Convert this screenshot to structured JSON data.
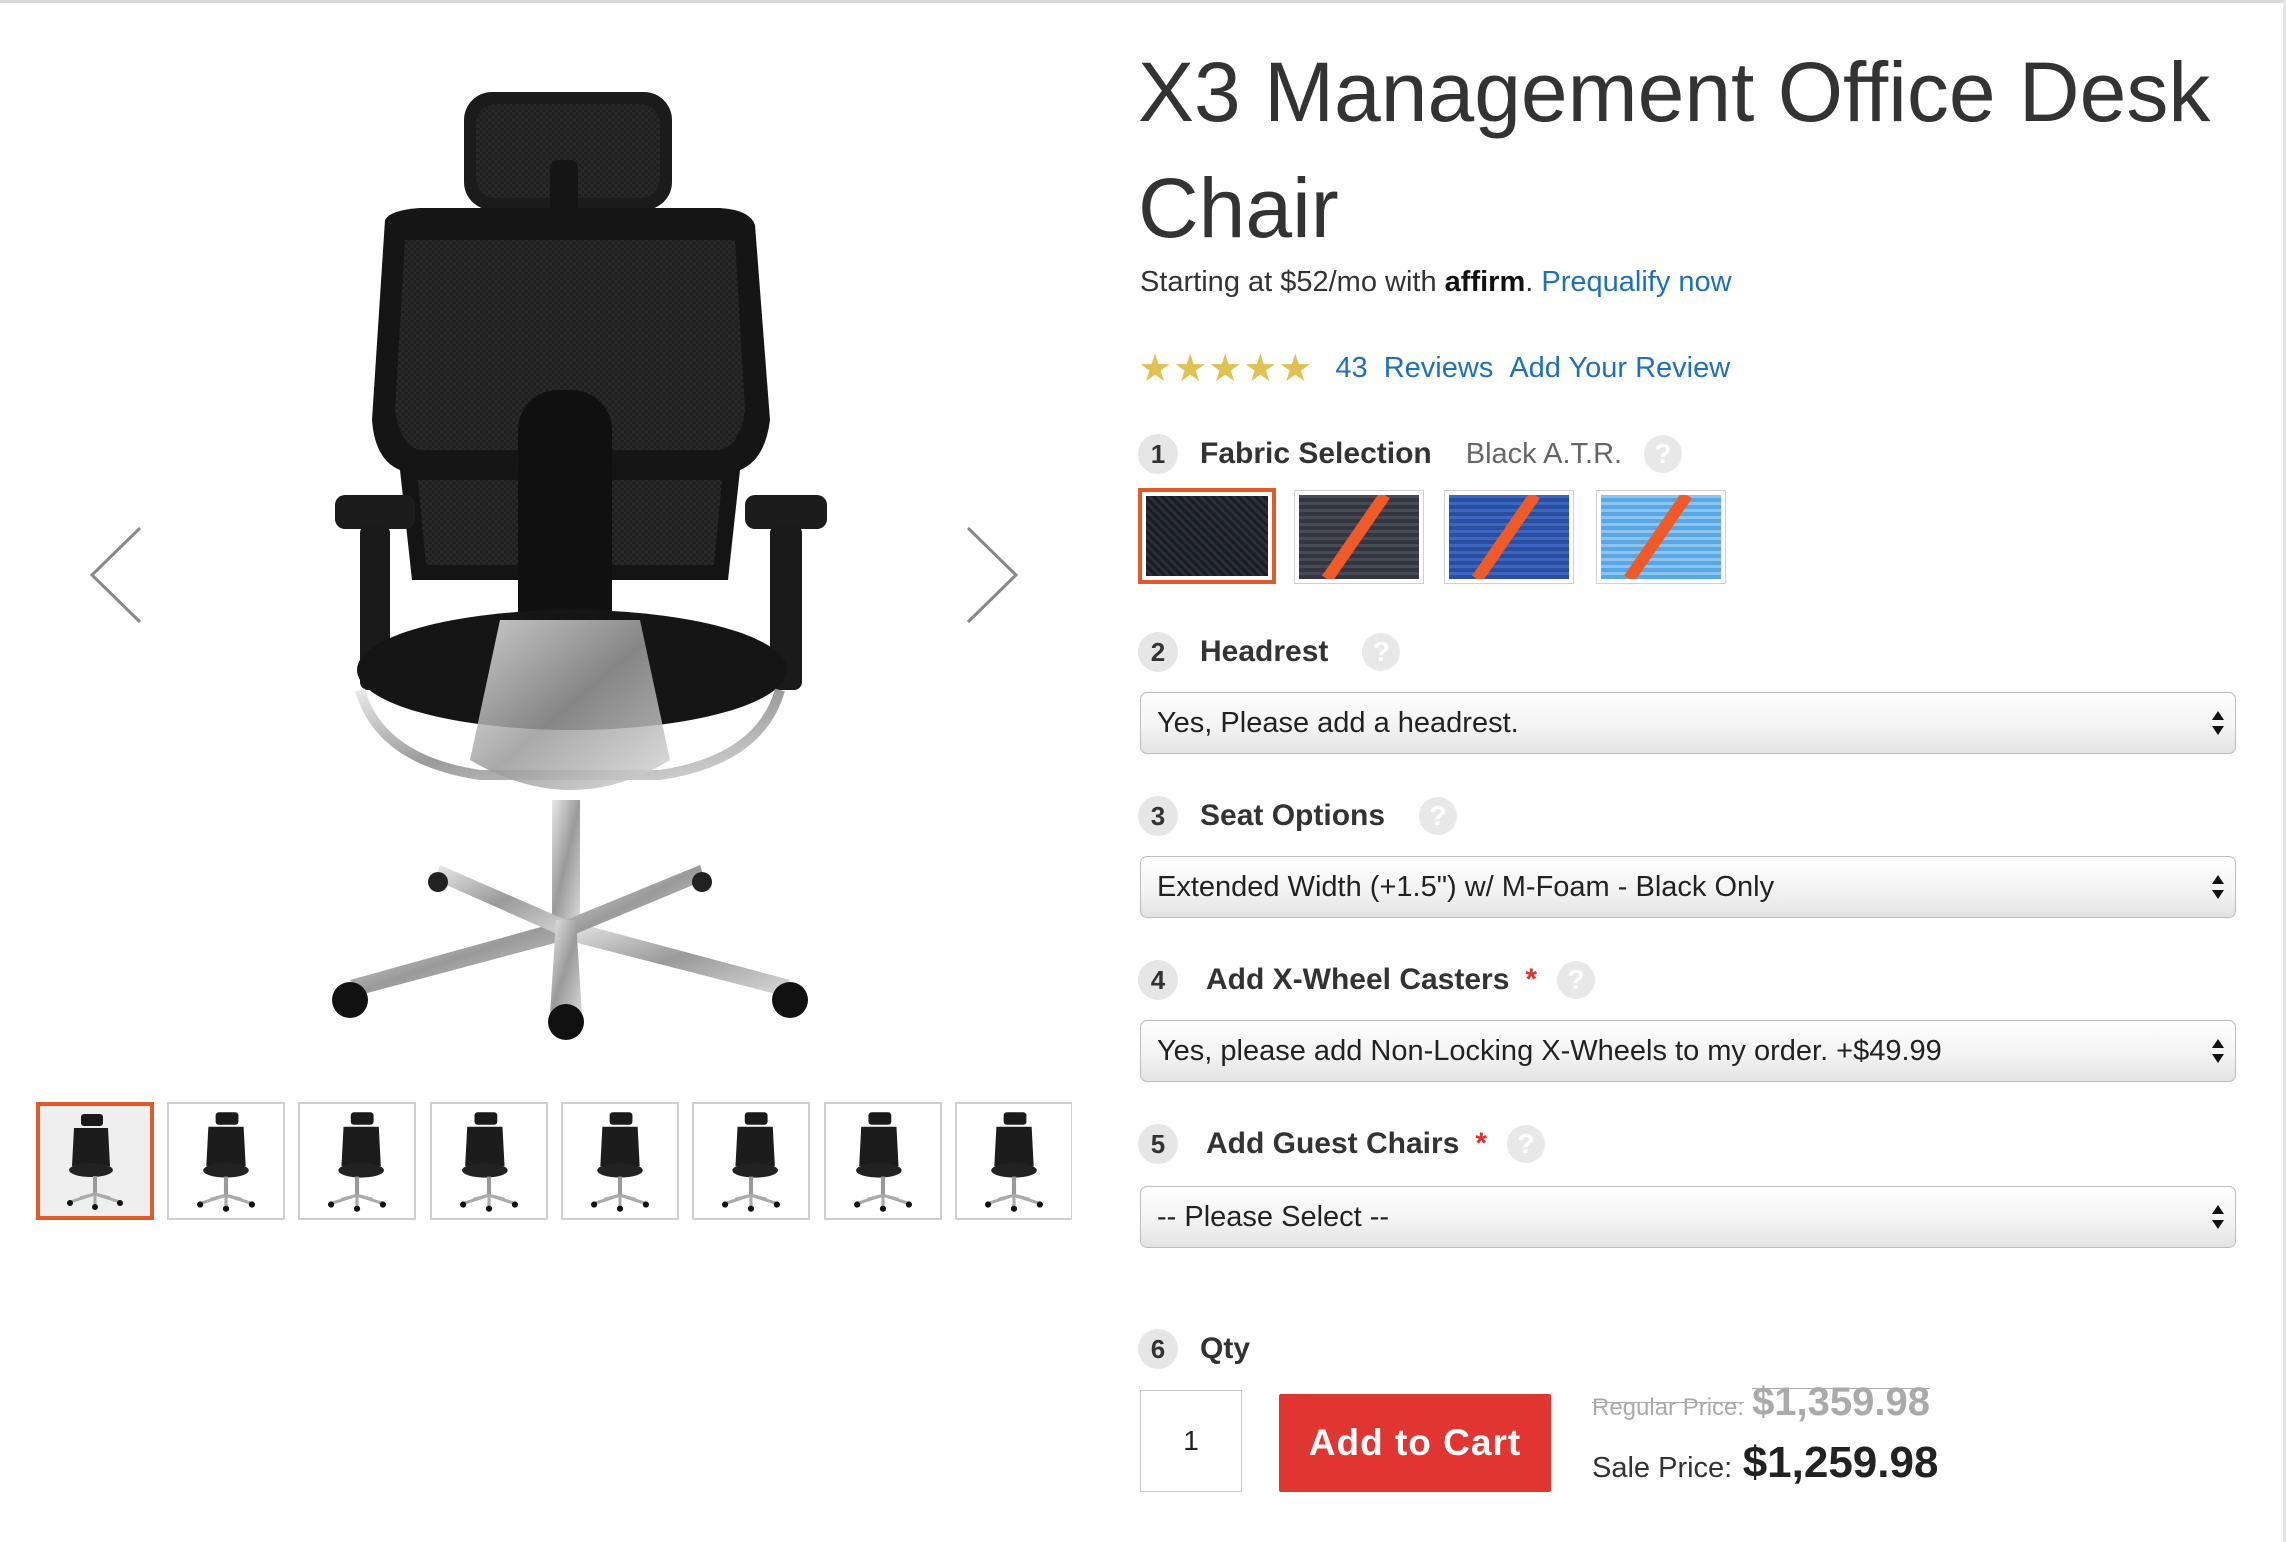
{
  "product": {
    "title": "X3 Management Office Desk Chair",
    "financing": {
      "prefix": "Starting at $52/mo with",
      "provider": "affirm",
      "suffix": ".",
      "link": "Prequalify now"
    },
    "rating": {
      "stars": "★★★★★",
      "review_count": "43",
      "reviews_label": "Reviews",
      "add_review": "Add Your Review"
    }
  },
  "gallery": {
    "prev_icon": "chevron-left-icon",
    "next_icon": "chevron-right-icon",
    "thumbnail_count": 8,
    "active_thumbnail": 1
  },
  "options": {
    "fabric": {
      "step": "1",
      "label": "Fabric Selection",
      "selected": "Black A.T.R.",
      "help": "?"
    },
    "headrest": {
      "step": "2",
      "label": "Headrest",
      "help": "?",
      "value": "Yes, Please add a headrest."
    },
    "seat": {
      "step": "3",
      "label": "Seat Options",
      "help": "?",
      "value": "Extended Width (+1.5\") w/ M-Foam - Black Only"
    },
    "casters": {
      "step": "4",
      "label": "Add X-Wheel Casters",
      "required": "*",
      "help": "?",
      "value": "Yes, please add Non-Locking X-Wheels to my order. +$49.99"
    },
    "guest": {
      "step": "5",
      "label": "Add Guest Chairs",
      "required": "*",
      "help": "?",
      "value": "-- Please Select --"
    },
    "qty": {
      "step": "6",
      "label": "Qty",
      "value": "1"
    }
  },
  "cart": {
    "button": "Add to Cart",
    "regular_label": "Regular Price:",
    "regular_price": "$1,359.98",
    "sale_label": "Sale Price:",
    "sale_price": "$1,259.98"
  },
  "colors": {
    "accent": "#e05a2a",
    "cart_button": "#e03530",
    "link": "#1f6fbf",
    "star": "#e0c152"
  }
}
